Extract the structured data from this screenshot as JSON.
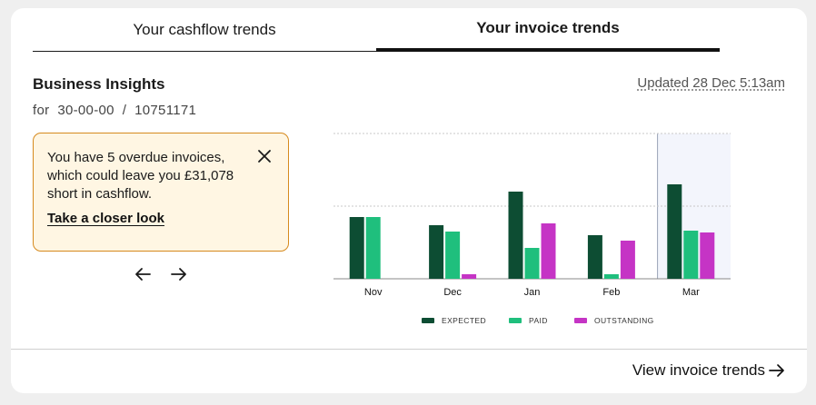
{
  "tabs": [
    {
      "label": "Your cashflow trends",
      "active": false
    },
    {
      "label": "Your invoice trends",
      "active": true
    }
  ],
  "header": {
    "title": "Business Insights",
    "subtitle": "for  30-00-00  /  10751171",
    "updated": "Updated 28 Dec 5:13am"
  },
  "alert": {
    "message": "You have 5 overdue invoices, which could leave you £31,078 short in cashflow.",
    "link": "Take a closer look",
    "close_icon": "close-icon"
  },
  "pager": {
    "prev_icon": "arrow-left-icon",
    "next_icon": "arrow-right-icon"
  },
  "footer": {
    "link": "View invoice trends",
    "icon": "arrow-right-icon"
  },
  "colors": {
    "expected": "#0d4d33",
    "paid": "#1fbf7d",
    "outstanding": "#c534c5",
    "alert_bg": "#fff6e3",
    "alert_border": "#d68a1e",
    "highlight": "#f3f5fc"
  },
  "chart_data": {
    "type": "bar",
    "categories": [
      "Nov",
      "Dec",
      "Jan",
      "Feb",
      "Mar"
    ],
    "series": [
      {
        "name": "EXPECTED",
        "values": [
          68,
          59,
          96,
          48,
          104
        ]
      },
      {
        "name": "PAID",
        "values": [
          68,
          52,
          34,
          5,
          53
        ]
      },
      {
        "name": "OUTSTANDING",
        "values": [
          0,
          5,
          61,
          42,
          51
        ]
      }
    ],
    "ylim": [
      0,
      160
    ],
    "grid": true,
    "legend": "bottom",
    "highlighted_category": "Mar"
  }
}
